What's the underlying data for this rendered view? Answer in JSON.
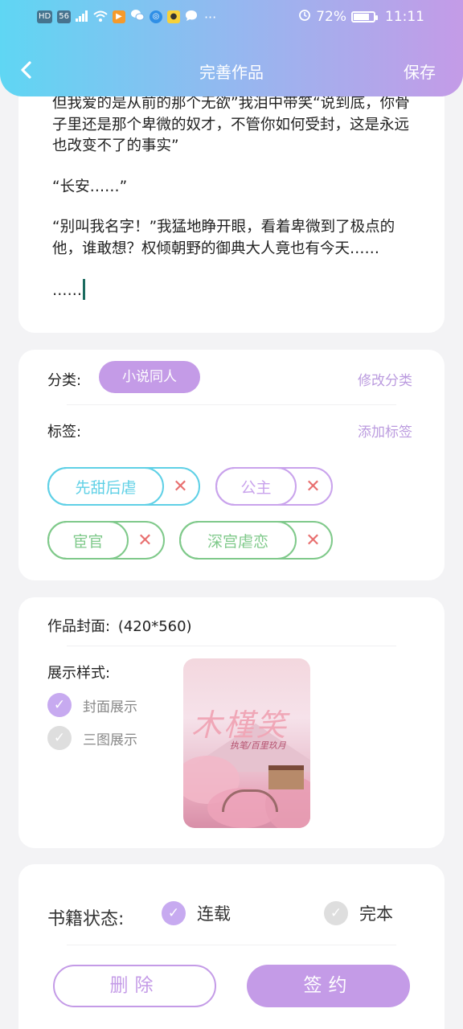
{
  "status_bar": {
    "left_icons": [
      "HD",
      "56",
      "signal-icon",
      "wifi-icon",
      "video-app-icon",
      "wechat-icon",
      "browser-icon",
      "app-icon",
      "message-icon",
      "more-icon"
    ],
    "battery": "72%",
    "time": "11:11"
  },
  "nav": {
    "back_icon": "chevron-left-icon",
    "title": "完善作品",
    "save": "保存"
  },
  "content": {
    "paragraphs": [
      "但我爱的是从前的那个无欲”我泪中带笑“说到底，你骨子里还是那个卑微的奴才，不管你如何受封，这是永远也改变不了的事实”",
      "“长安……”",
      "“别叫我名字！”我猛地睁开眼，看着卑微到了极点的他，谁敢想？权倾朝野的御典大人竟也有今天……",
      "……"
    ]
  },
  "category": {
    "label": "分类:",
    "value": "小说同人",
    "edit": "修改分类"
  },
  "tags": {
    "label": "标签:",
    "add": "添加标签",
    "items": [
      {
        "name": "先甜后虐",
        "color": "#5fd0e6"
      },
      {
        "name": "公主",
        "color": "#c9a3ec"
      },
      {
        "name": "宦官",
        "color": "#7fc98a"
      },
      {
        "name": "深宫虐恋",
        "color": "#7fc98a"
      }
    ],
    "remove_icon": "close-icon",
    "remove_color": "#e87070"
  },
  "cover": {
    "label": "作品封面:",
    "size": "(420*560)",
    "display_label": "展示样式:",
    "options": [
      {
        "label": "封面展示",
        "checked": true
      },
      {
        "label": "三图展示",
        "checked": false
      }
    ],
    "image_title": "木槿笑",
    "image_subtitle": "执笔/百里玖月"
  },
  "book_status": {
    "label": "书籍状态:",
    "options": [
      {
        "label": "连载",
        "checked": true
      },
      {
        "label": "完本",
        "checked": false
      }
    ]
  },
  "actions": {
    "delete": "删除",
    "sign": "签约"
  },
  "colors": {
    "accent": "#c49be7",
    "header_gradient_start": "#5fd6f3",
    "header_gradient_end": "#c49be7"
  }
}
